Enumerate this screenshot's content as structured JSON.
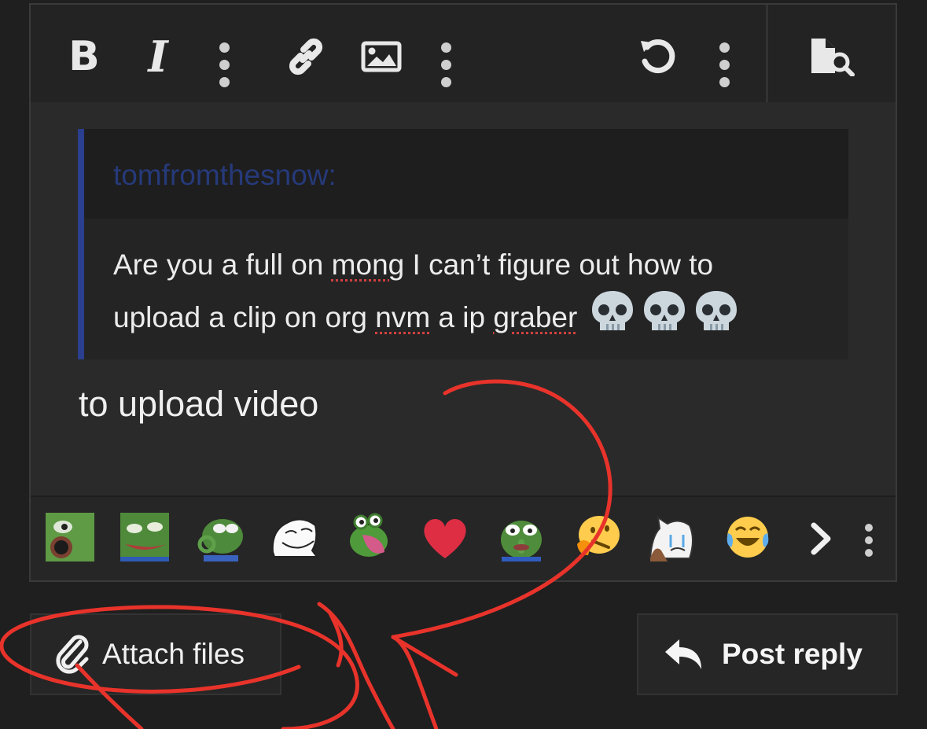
{
  "toolbar": {
    "bold_label": "B",
    "italic_label": "I",
    "icons": [
      "bold-icon",
      "italic-icon",
      "more-icon",
      "link-icon",
      "image-icon",
      "more-icon",
      "undo-icon",
      "more-icon",
      "preview-icon"
    ]
  },
  "quote": {
    "author": "tomfromthesnow:",
    "line1_a": "Are you a full on ",
    "line1_mong": "mong",
    "line1_b": " I can’t figure out how to",
    "line2_a": "upload a clip on org ",
    "line2_nvm": "nvm",
    "line2_b": " a ip ",
    "line2_graber": "graber",
    "emoji": "skull-emoji x3"
  },
  "reply_text": "to upload video",
  "emoji_bar": {
    "items": [
      "pepe-o-mouth",
      "pepe-tongue",
      "pepe-ok-hand",
      "trollface",
      "pepe-scream",
      "red-heart",
      "pepe-shush",
      "thinking-face",
      "crying-wojak",
      "joy-face"
    ],
    "heart_color": "#dd2e44"
  },
  "buttons": {
    "attach_label": "Attach files",
    "post_label": "Post reply"
  },
  "colors": {
    "quote_border": "#2a3f8f",
    "quote_author": "#263a7a",
    "annotation": "#e8332b"
  }
}
